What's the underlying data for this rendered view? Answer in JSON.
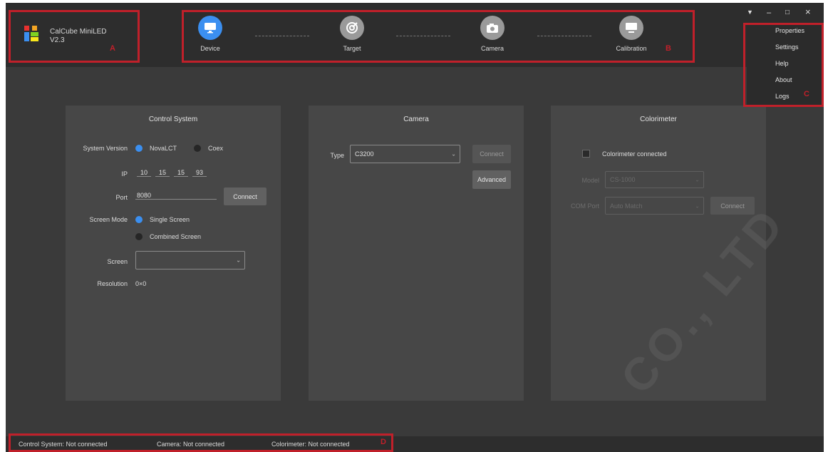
{
  "app": {
    "name": "CalCube MiniLED",
    "version": "V2.3",
    "logo_colors": [
      "#e8312f",
      "#f5a623",
      "#7ed321",
      "#3b8ff0",
      "#f8e71c"
    ]
  },
  "steps": [
    {
      "label": "Device",
      "icon": "monitor-icon",
      "active": true
    },
    {
      "label": "Target",
      "icon": "target-icon",
      "active": false
    },
    {
      "label": "Camera",
      "icon": "camera-icon",
      "active": false
    },
    {
      "label": "Calibration",
      "icon": "display-icon",
      "active": false
    }
  ],
  "window_controls": {
    "menu": "▼",
    "minimize": "–",
    "maximize": "□",
    "close": "×"
  },
  "menu": {
    "items": [
      "Properties",
      "Settings",
      "Help",
      "About",
      "Logs"
    ]
  },
  "annotations": {
    "a": "A",
    "b": "B",
    "c": "C",
    "d": "D"
  },
  "control_system": {
    "title": "Control System",
    "system_version_label": "System Version",
    "version_options": [
      "NovaLCT",
      "Coex"
    ],
    "selected_version": "NovaLCT",
    "ip_label": "IP",
    "ip": [
      "10",
      "15",
      "15",
      "93"
    ],
    "port_label": "Port",
    "port_value": "8080",
    "connect_label": "Connect",
    "screen_mode_label": "Screen Mode",
    "screen_mode_options": [
      "Single Screen",
      "Combined Screen"
    ],
    "selected_screen_mode": "Single Screen",
    "screen_label": "Screen",
    "screen_value": "",
    "resolution_label": "Resolution",
    "resolution_value": "0×0"
  },
  "camera": {
    "title": "Camera",
    "type_label": "Type",
    "type_value": "C3200",
    "connect_label": "Connect",
    "advanced_label": "Advanced"
  },
  "colorimeter": {
    "title": "Colorimeter",
    "checkbox_label": "Colorimeter connected",
    "model_label": "Model",
    "model_value": "CS-1000",
    "com_port_label": "COM Port",
    "com_port_value": "Auto Match",
    "connect_label": "Connect"
  },
  "status_bar": {
    "control_system": "Control System: Not connected",
    "camera": "Camera: Not connected",
    "colorimeter": "Colorimeter: Not connected"
  },
  "watermark": "CO., LTD"
}
